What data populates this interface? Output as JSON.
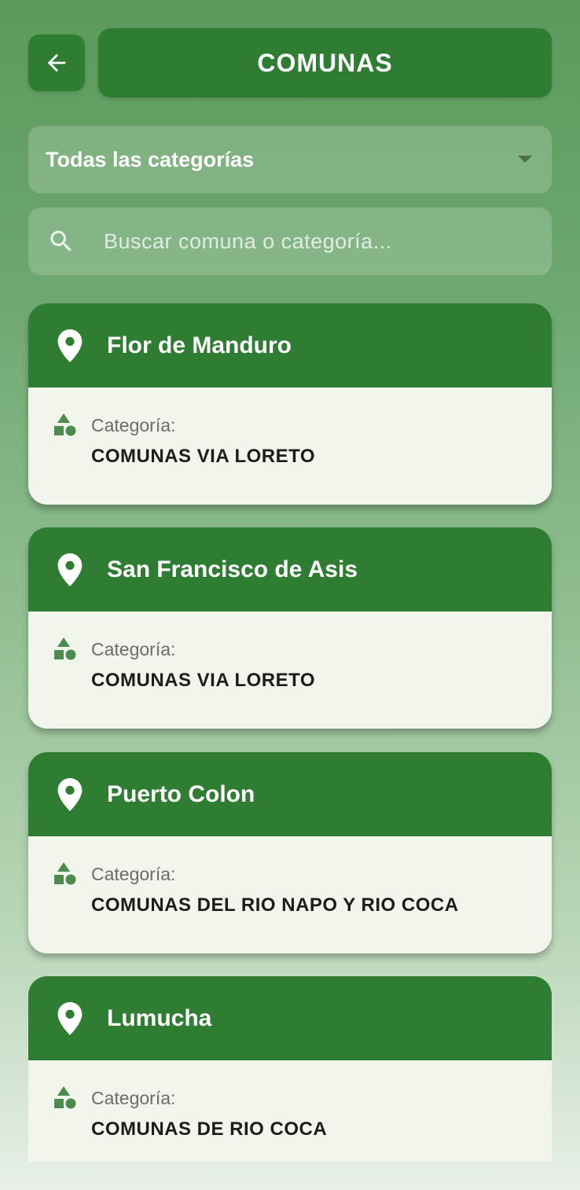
{
  "header": {
    "back_icon": "arrow-left-icon",
    "title": "COMUNAS"
  },
  "filter": {
    "selected": "Todas las categorías",
    "icon": "caret-down-icon"
  },
  "search": {
    "icon": "search-icon",
    "placeholder": "Buscar comuna o categoría..."
  },
  "colors": {
    "primary": "#2e7d32",
    "card_body": "#f1f5ec"
  },
  "communes": [
    {
      "name": "Flor de Manduro",
      "category_label": "Categoría:",
      "category": "COMUNAS VIA LORETO"
    },
    {
      "name": "San Francisco de Asis",
      "category_label": "Categoría:",
      "category": "COMUNAS VIA LORETO"
    },
    {
      "name": "Puerto Colon",
      "category_label": "Categoría:",
      "category": "COMUNAS DEL RIO NAPO Y RIO COCA"
    },
    {
      "name": "Lumucha",
      "category_label": "Categoría:",
      "category": "COMUNAS DE RIO COCA"
    }
  ]
}
